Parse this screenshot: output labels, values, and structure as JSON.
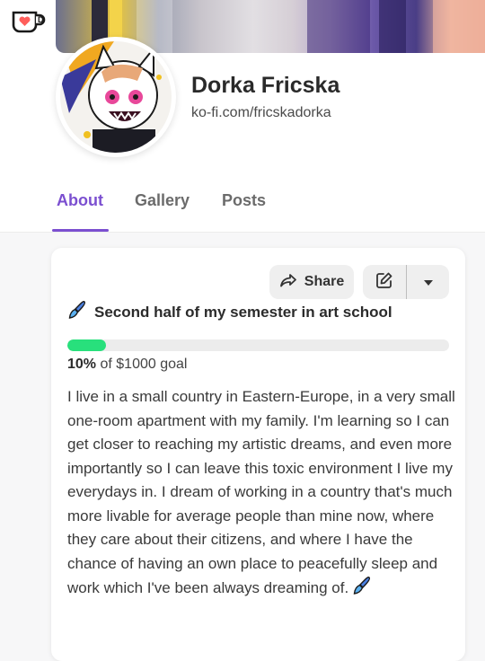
{
  "profile": {
    "name": "Dorka Fricska",
    "url": "ko-fi.com/fricskadorka"
  },
  "tabs": [
    {
      "label": "About",
      "active": true
    },
    {
      "label": "Gallery",
      "active": false
    },
    {
      "label": "Posts",
      "active": false
    }
  ],
  "card": {
    "share_label": "Share",
    "goal": {
      "title": "Second half of my semester in art school",
      "percent_label": "10%",
      "suffix": " of $1000 goal",
      "progress_fraction": 0.1
    },
    "description": "I live in a small country in Eastern-Europe, in a very small one-room apartment with my family. I'm learning so I can get closer to reaching my artistic dreams, and even more importantly so I can leave this toxic environment I live my everydays in. I dream of working in a country that's much more livable for average people than mine now, where they care about their citizens, and where I have the chance of having an own place to peacefully sleep and work which I've been always dreaming of."
  },
  "icons": {
    "logo": "ko-fi-cup-icon",
    "share": "share-arrow-icon",
    "edit": "pencil-square-icon",
    "caret": "caret-down-icon",
    "goal": "paintbrush-icon"
  },
  "colors": {
    "accent": "#7b4fd0",
    "progress": "#28e07c",
    "logo_heart": "#ff5e5b"
  }
}
